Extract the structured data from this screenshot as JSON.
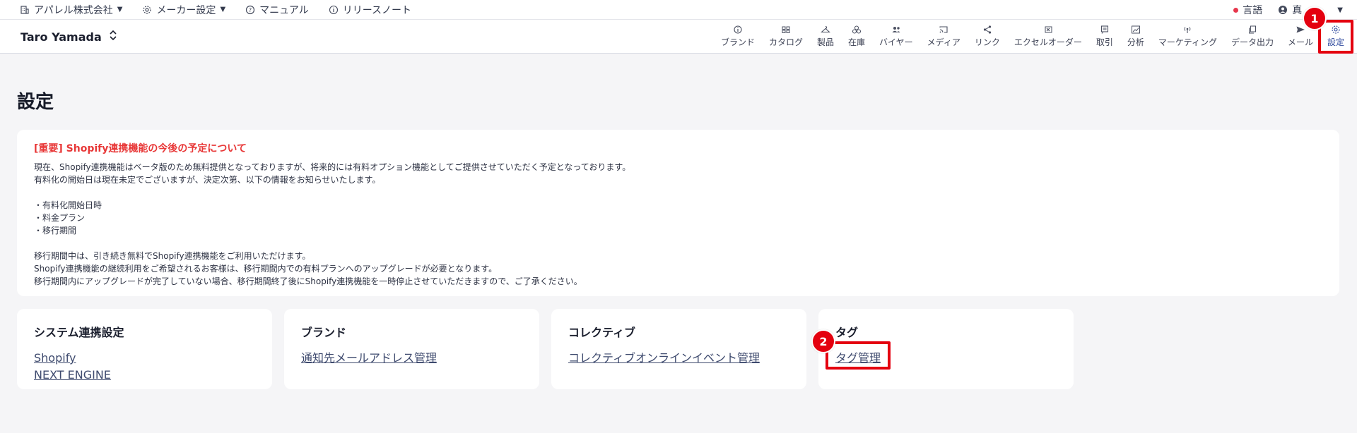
{
  "topbar": {
    "company": "アパレル株式会社",
    "maker_settings": "メーカー設定",
    "manual": "マニュアル",
    "release_notes": "リリースノート",
    "language": "言語",
    "user_short": "真"
  },
  "navbar": {
    "user_name": "Taro Yamada",
    "items": [
      {
        "label": "ブランド",
        "icon": "info-icon"
      },
      {
        "label": "カタログ",
        "icon": "catalog-icon"
      },
      {
        "label": "製品",
        "icon": "hanger-icon"
      },
      {
        "label": "在庫",
        "icon": "stock-icon"
      },
      {
        "label": "バイヤー",
        "icon": "buyers-icon"
      },
      {
        "label": "メディア",
        "icon": "cast-icon"
      },
      {
        "label": "リンク",
        "icon": "share-icon"
      },
      {
        "label": "エクセルオーダー",
        "icon": "excel-icon"
      },
      {
        "label": "取引",
        "icon": "transaction-icon"
      },
      {
        "label": "分析",
        "icon": "chart-icon"
      },
      {
        "label": "マーケティング",
        "icon": "broadcast-icon"
      },
      {
        "label": "データ出力",
        "icon": "copy-icon"
      },
      {
        "label": "メール",
        "icon": "send-icon"
      },
      {
        "label": "設定",
        "icon": "gear-icon"
      }
    ]
  },
  "page": {
    "title": "設定"
  },
  "notice": {
    "title": "[重要] Shopify連携機能の今後の予定について",
    "lines": [
      "現在、Shopify連携機能はベータ版のため無料提供となっておりますが、将来的には有料オプション機能としてご提供させていただく予定となっております。",
      "有料化の開始日は現在未定でございますが、決定次第、以下の情報をお知らせいたします。",
      "",
      "・有料化開始日時",
      "・料金プラン",
      "・移行期間",
      "",
      "移行期間中は、引き続き無料でShopify連携機能をご利用いただけます。",
      "Shopify連携機能の継続利用をご希望されるお客様は、移行期間内での有料プランへのアップグレードが必要となります。",
      "移行期間内にアップグレードが完了していない場合、移行期間終了後にShopify連携機能を一時停止させていただきますので、ご了承ください。"
    ]
  },
  "cards": [
    {
      "title": "システム連携設定",
      "links": [
        "Shopify",
        "NEXT ENGINE"
      ]
    },
    {
      "title": "ブランド",
      "links": [
        "通知先メールアドレス管理"
      ]
    },
    {
      "title": "コレクティブ",
      "links": [
        "コレクティブオンラインイベント管理"
      ]
    },
    {
      "title": "タグ",
      "links": [
        "タグ管理"
      ]
    }
  ],
  "annotations": {
    "badge1": "1",
    "badge2": "2",
    "color": "#e4000f"
  }
}
